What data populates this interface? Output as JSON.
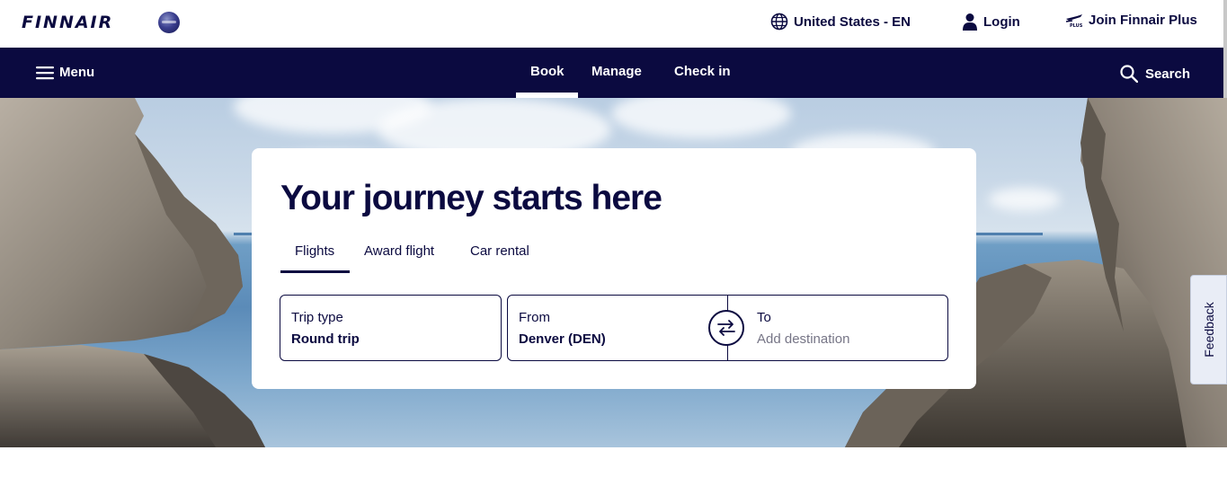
{
  "header": {
    "logo_text": "FINNAIR",
    "alliance_logo": "oneworld-globe-logo",
    "region_label": "United States - EN",
    "login_label": "Login",
    "join_label": "Join Finnair Plus",
    "icons": [
      "globe-icon",
      "user-icon",
      "finnair-plus-icon"
    ]
  },
  "nav": {
    "menu_label": "Menu",
    "tabs": [
      {
        "label": "Book",
        "active": true
      },
      {
        "label": "Manage",
        "active": false
      },
      {
        "label": "Check in",
        "active": false
      }
    ],
    "search_label": "Search",
    "background": "#0b0a40"
  },
  "booking": {
    "title": "Your journey starts here",
    "tabs": [
      {
        "label": "Flights",
        "active": true
      },
      {
        "label": "Award flight",
        "active": false
      },
      {
        "label": "Car rental",
        "active": false
      }
    ],
    "trip_type": {
      "label": "Trip type",
      "value": "Round trip"
    },
    "from": {
      "label": "From",
      "value": "Denver (DEN)"
    },
    "to": {
      "label": "To",
      "placeholder": "Add destination"
    },
    "swap_icon": "swap-arrows-icon"
  },
  "feedback": {
    "label": "Feedback"
  },
  "colors": {
    "brand_navy": "#0b0a40",
    "placeholder": "#767586",
    "feedback_bg": "#e9edf6"
  }
}
